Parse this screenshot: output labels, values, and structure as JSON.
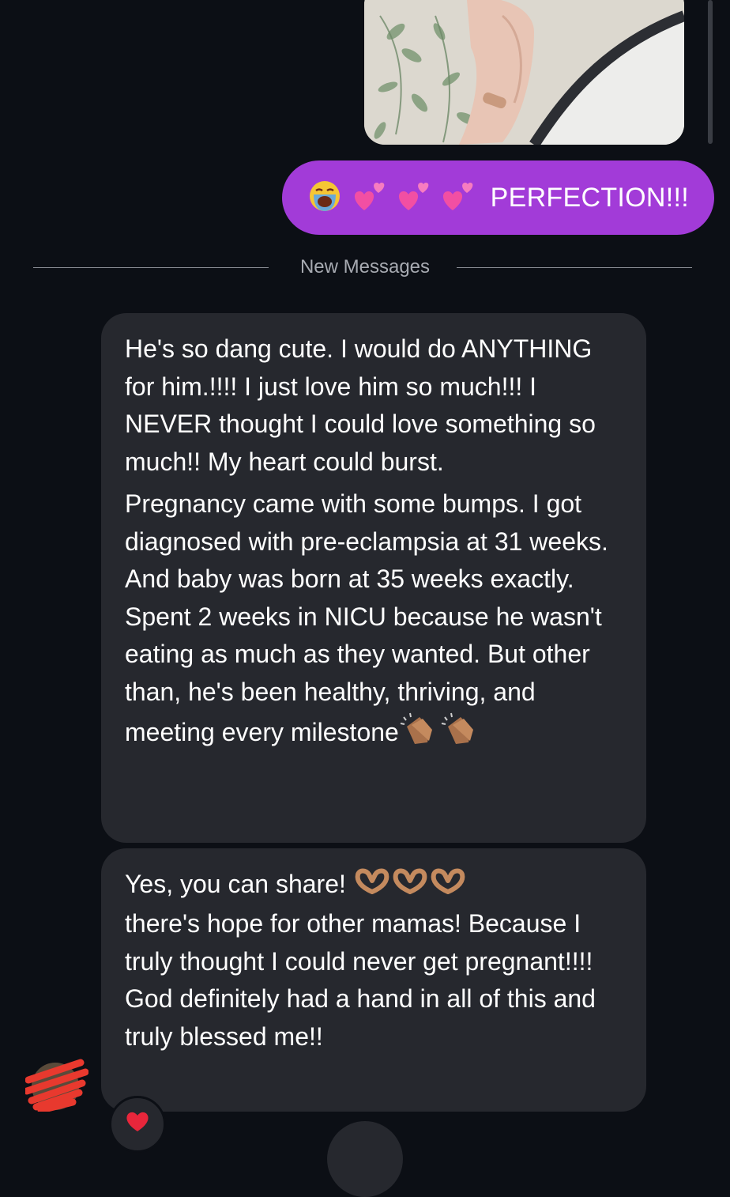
{
  "sent_message": {
    "emojis": [
      "loudly-crying-face",
      "two-hearts",
      "two-hearts",
      "two-hearts"
    ],
    "text": "PERFECTION!!!",
    "bubble_color": "#a23bd8"
  },
  "divider": {
    "label": "New Messages"
  },
  "received_messages": [
    {
      "paragraphs": [
        "He's so dang cute. I would do ANYTHING for him.!!!! I just love him so much!!! I NEVER thought I could love something so much!!  My heart could burst.",
        "Pregnancy came with some bumps. I got diagnosed with pre-eclampsia at 31 weeks. And baby was born at 35 weeks exactly. Spent 2 weeks in NICU because he wasn't eating as much as they wanted. But other than, he's been healthy, thriving, and meeting every milestone"
      ],
      "trailing_emojis": [
        "clapping-hands",
        "clapping-hands"
      ]
    },
    {
      "lead": "Yes, you can share!",
      "lead_emojis": [
        "heart-hands",
        "heart-hands",
        "heart-hands"
      ],
      "rest": "there's hope for other mamas! Because I truly thought I could never get pregnant!!!! God definitely had a hand in all of this and truly blessed me!!"
    }
  ],
  "reaction": {
    "emoji": "red-heart"
  },
  "colors": {
    "background": "#0c0f15",
    "received_bubble": "#26282e",
    "accent": "#a23bd8"
  }
}
